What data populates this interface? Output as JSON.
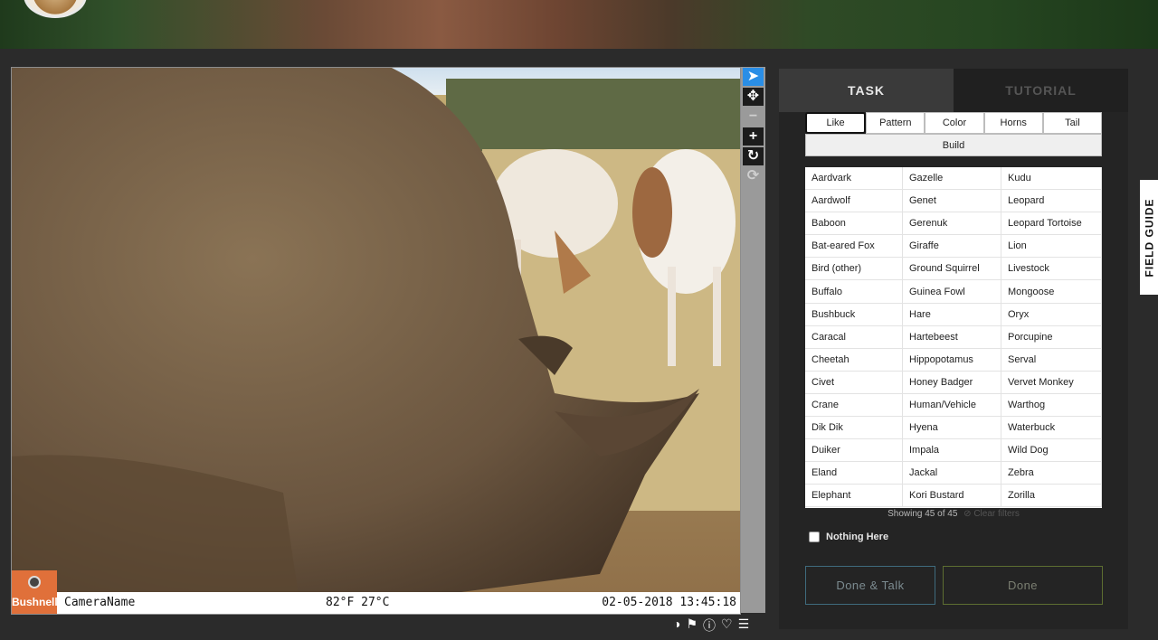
{
  "camera": {
    "brand": "Bushnell",
    "camera_name": "CameraName",
    "temperature": "82°F 27°C",
    "timestamp": "02-05-2018 13:45:18"
  },
  "toolbar": {
    "icons": [
      "pointer-icon",
      "move-icon",
      "zoom-out-icon",
      "zoom-in-icon",
      "rotate-icon",
      "reset-icon"
    ]
  },
  "meta_icons": [
    "invert-icon",
    "flag-icon",
    "info-icon",
    "favorite-icon",
    "collections-icon"
  ],
  "panel": {
    "tabs": [
      {
        "label": "TASK",
        "active": true
      },
      {
        "label": "TUTORIAL",
        "active": false
      }
    ],
    "filters": [
      "Like",
      "Pattern",
      "Color",
      "Horns",
      "Tail"
    ],
    "selected_filter": "Like",
    "build_label": "Build",
    "choices": [
      "Aardvark",
      "Gazelle",
      "Kudu",
      "Aardwolf",
      "Genet",
      "Leopard",
      "Baboon",
      "Gerenuk",
      "Leopard Tortoise",
      "Bat-eared Fox",
      "Giraffe",
      "Lion",
      "Bird (other)",
      "Ground Squirrel",
      "Livestock",
      "Buffalo",
      "Guinea Fowl",
      "Mongoose",
      "Bushbuck",
      "Hare",
      "Oryx",
      "Caracal",
      "Hartebeest",
      "Porcupine",
      "Cheetah",
      "Hippopotamus",
      "Serval",
      "Civet",
      "Honey Badger",
      "Vervet Monkey",
      "Crane",
      "Human/Vehicle",
      "Warthog",
      "Dik Dik",
      "Hyena",
      "Waterbuck",
      "Duiker",
      "Impala",
      "Wild Dog",
      "Eland",
      "Jackal",
      "Zebra",
      "Elephant",
      "Kori Bustard",
      "Zorilla"
    ],
    "showing_text": "Showing 45 of 45",
    "clear_filters": "Clear filters",
    "nothing_here": "Nothing Here",
    "done_talk_label": "Done & Talk",
    "done_label": "Done"
  },
  "field_guide_label": "FIELD GUIDE",
  "colors": {
    "active_tool": "#2a8ee6",
    "done_talk_border": "#3f6b7d",
    "done_border": "#5d6e31",
    "panel_bg": "#242424"
  }
}
